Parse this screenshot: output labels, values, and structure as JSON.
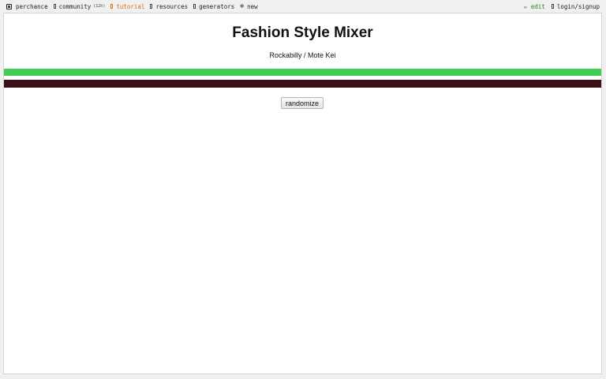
{
  "nav": {
    "items": [
      {
        "label": "perchance",
        "icon": "die-icon"
      },
      {
        "label": "community",
        "badge": "(12h)",
        "icon": "chat-icon"
      },
      {
        "label": "tutorial",
        "icon": "book-icon",
        "color": "#d8740c"
      },
      {
        "label": "resources",
        "icon": "folder-icon"
      },
      {
        "label": "generators",
        "icon": "list-icon"
      },
      {
        "label": "new",
        "icon": "plus-circle-icon"
      }
    ],
    "edit_label": "✏ edit",
    "edit_color": "#1d8a1d",
    "login_label": "login/signup",
    "login_icon": "user-icon"
  },
  "main": {
    "title": "Fashion Style Mixer",
    "subtitle": "Rockabilly / Mote Kei",
    "colors": [
      "#44cc55",
      "#3a1015"
    ],
    "randomize_label": "randomize"
  }
}
